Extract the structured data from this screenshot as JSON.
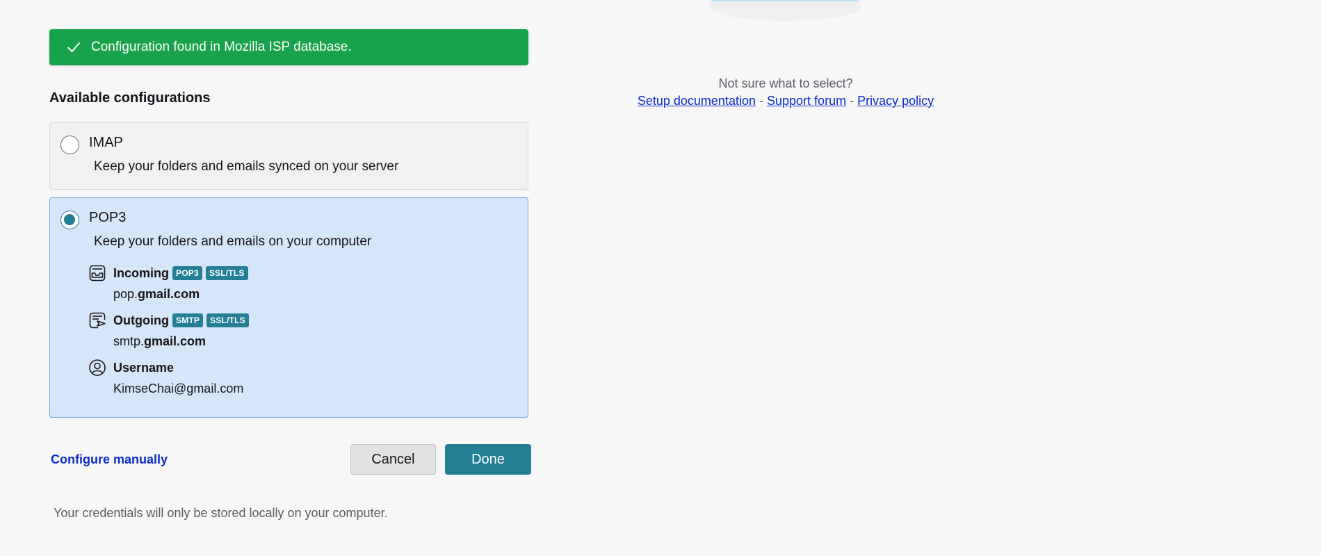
{
  "banner": {
    "icon": "checkmark-icon",
    "text": "Configuration found in Mozilla ISP database.",
    "color": "#18a24b"
  },
  "configs": {
    "title": "Available configurations",
    "imap": {
      "label": "IMAP",
      "description": "Keep your folders and emails synced on your server",
      "selected": false
    },
    "pop3": {
      "label": "POP3",
      "description": "Keep your folders and emails on your computer",
      "selected": true,
      "incoming": {
        "icon": "inbox-icon",
        "label": "Incoming",
        "badges": [
          "POP3",
          "SSL/TLS"
        ],
        "host_prefix": "pop.",
        "host_domain": "gmail.com"
      },
      "outgoing": {
        "icon": "outbox-send-icon",
        "label": "Outgoing",
        "badges": [
          "SMTP",
          "SSL/TLS"
        ],
        "host_prefix": "smtp.",
        "host_domain": "gmail.com"
      },
      "username": {
        "icon": "user-circle-icon",
        "label": "Username",
        "value": "KimseChai@gmail.com"
      }
    }
  },
  "actions": {
    "configure_manually": "Configure manually",
    "cancel": "Cancel",
    "done": "Done"
  },
  "footer": {
    "credentials_note": "Your credentials will only be stored locally on your computer."
  },
  "help": {
    "question": "Not sure what to select?",
    "separator": "-",
    "setup_docs": "Setup documentation",
    "support_forum": "Support forum",
    "privacy_policy": "Privacy policy"
  },
  "colors": {
    "accent": "#247f94",
    "selected_bg": "#d4e6f8",
    "link": "#0b2bc9"
  }
}
